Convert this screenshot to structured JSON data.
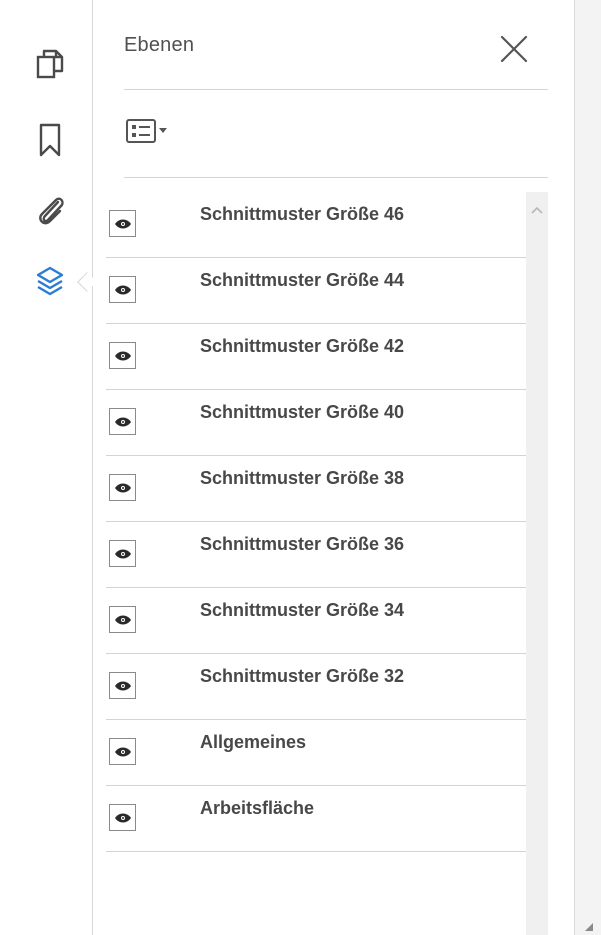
{
  "rail": {
    "items": [
      {
        "icon": "pages-icon",
        "active": false
      },
      {
        "icon": "bookmark-icon",
        "active": false
      },
      {
        "icon": "attachment-icon",
        "active": false
      },
      {
        "icon": "layers-icon",
        "active": true
      }
    ],
    "active_color": "#2b7cd3",
    "icon_color": "#4a4a4a"
  },
  "panel": {
    "title": "Ebenen",
    "close_icon": "close-icon",
    "options_icon": "options-menu-icon"
  },
  "layers": [
    {
      "label": "Schnittmuster Größe 46",
      "visible": true
    },
    {
      "label": "Schnittmuster Größe 44",
      "visible": true
    },
    {
      "label": "Schnittmuster Größe 42",
      "visible": true
    },
    {
      "label": "Schnittmuster Größe 40",
      "visible": true
    },
    {
      "label": "Schnittmuster Größe 38",
      "visible": true
    },
    {
      "label": "Schnittmuster Größe 36",
      "visible": true
    },
    {
      "label": "Schnittmuster Größe 34",
      "visible": true
    },
    {
      "label": "Schnittmuster Größe 32",
      "visible": true
    },
    {
      "label": "Allgemeines",
      "visible": true
    },
    {
      "label": "Arbeitsfläche",
      "visible": true
    }
  ]
}
